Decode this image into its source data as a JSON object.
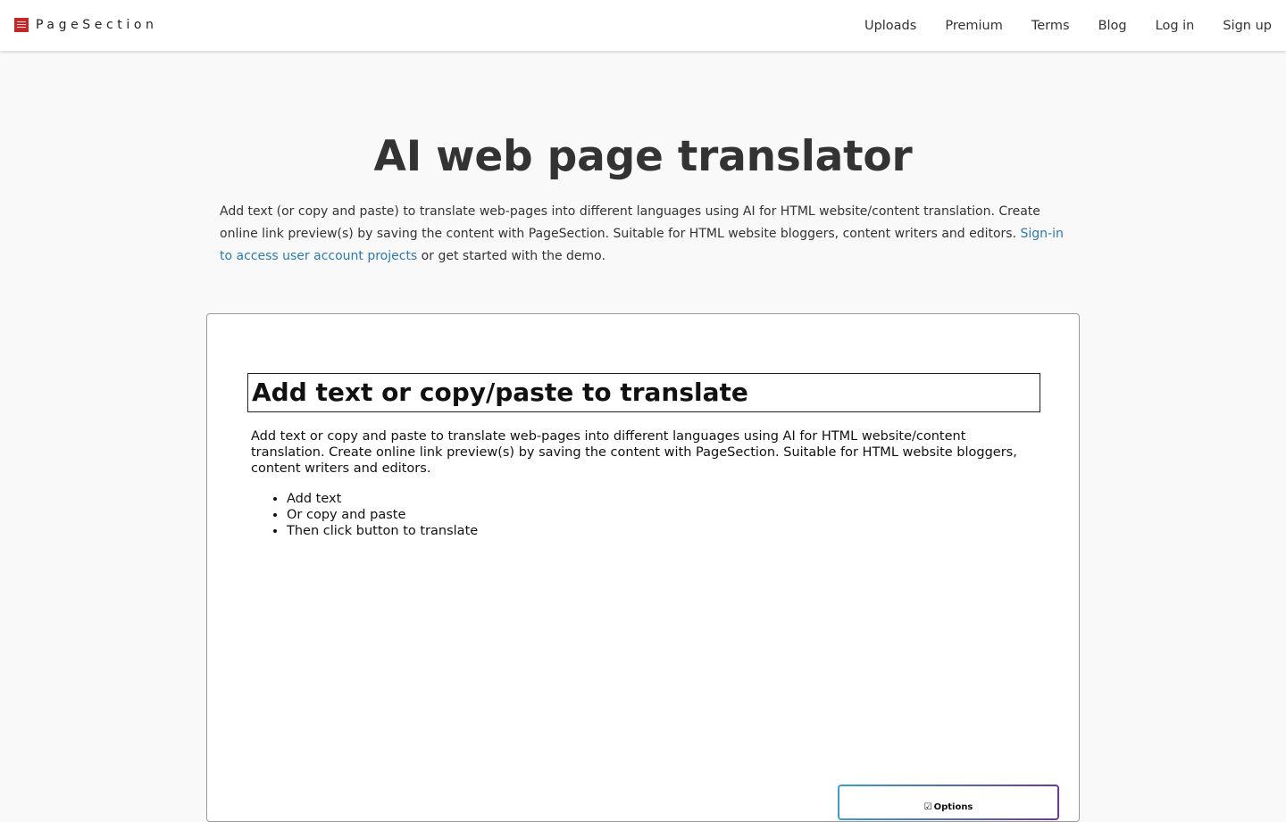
{
  "brand": {
    "name": "PageSection",
    "logo_color": "#c62828"
  },
  "nav": {
    "items": [
      {
        "label": "Uploads"
      },
      {
        "label": "Premium"
      },
      {
        "label": "Terms"
      },
      {
        "label": "Blog"
      },
      {
        "label": "Log in"
      },
      {
        "label": "Sign up"
      }
    ]
  },
  "hero": {
    "title": "AI web page translator",
    "description_start": "Add text (or copy and paste) to translate web-pages into different languages using AI for HTML website/content translation. Create online link preview(s) by saving the content with PageSection. Suitable for HTML website bloggers, content writers and editors. ",
    "signin_link": "Sign-in to access user account projects",
    "description_end": " or get started with the demo.",
    "link_color": "#2a7ab8"
  },
  "editor": {
    "heading": "Add text or copy/paste to translate",
    "body": "Add text or copy and paste to translate web-pages into different languages using AI for HTML website/content translation. Create online link preview(s) by saving the content with PageSection. Suitable for HTML website bloggers, content writers and editors.",
    "list": [
      "Add text",
      "Or copy and paste",
      "Then click button to translate"
    ],
    "options_label": "Options",
    "options_icon": "edit-check-icon"
  }
}
